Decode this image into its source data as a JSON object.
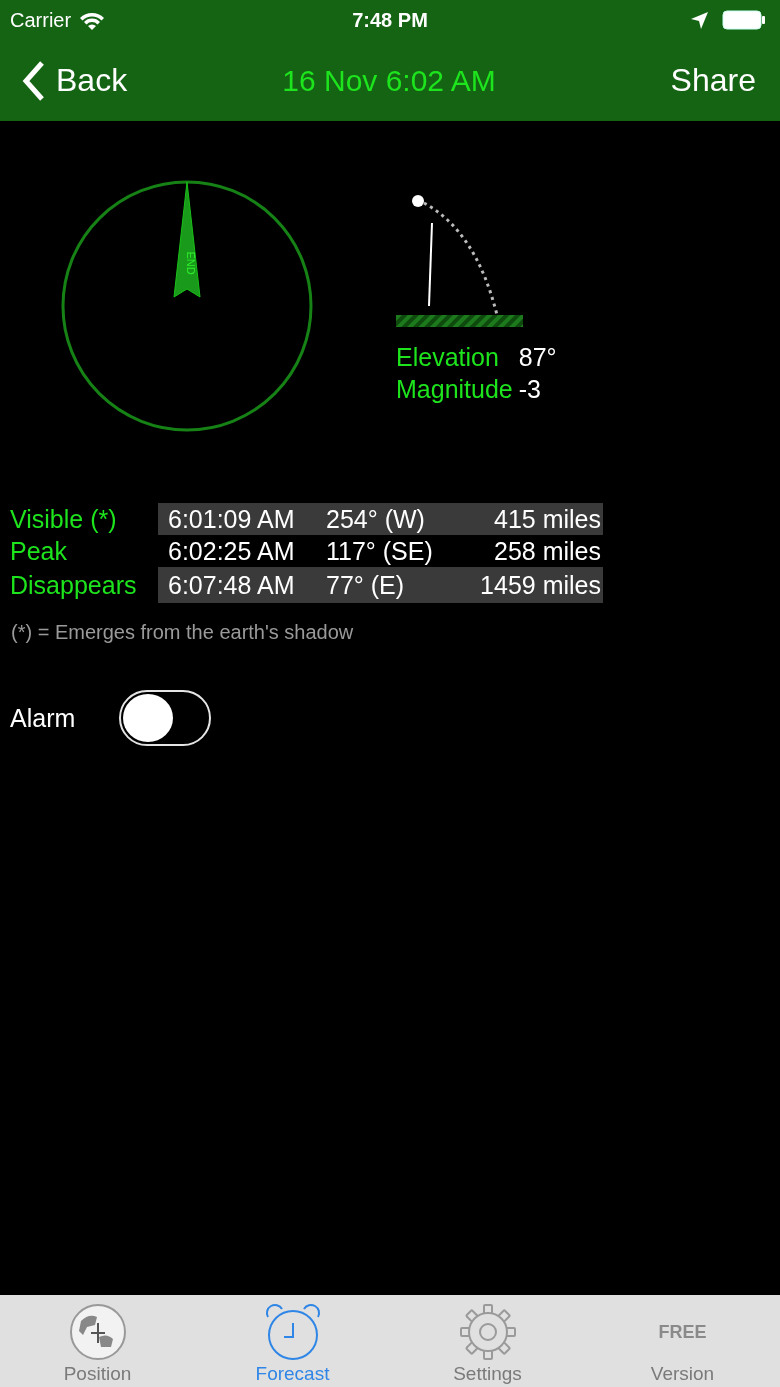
{
  "status_bar": {
    "carrier": "Carrier",
    "time": "7:48 PM"
  },
  "nav_bar": {
    "back": "Back",
    "title": "16 Nov 6:02 AM",
    "action": "Share"
  },
  "compass": {
    "pointer_label": "END"
  },
  "elevation": {
    "rows": [
      {
        "label": "Elevation",
        "value": "87°"
      },
      {
        "label": "Magnitude",
        "value": "-3"
      }
    ]
  },
  "pass_table": {
    "rows": [
      {
        "label": "Visible (*)",
        "time": "6:01:09 AM",
        "direction": "254° (W)",
        "distance": "415 miles"
      },
      {
        "label": "Peak",
        "time": "6:02:25 AM",
        "direction": "117° (SE)",
        "distance": "258 miles"
      },
      {
        "label": "Disappears",
        "time": "6:07:48 AM",
        "direction": "77° (E)",
        "distance": "1459 miles"
      }
    ]
  },
  "footnote": "(*) = Emerges from the earth's shadow",
  "alarm": {
    "label": "Alarm",
    "on": false
  },
  "tab_bar": [
    {
      "kind": "globe",
      "label": "Position",
      "selected": false
    },
    {
      "kind": "alarm",
      "label": "Forecast",
      "selected": true
    },
    {
      "kind": "gear",
      "label": "Settings",
      "selected": false
    },
    {
      "kind": "free",
      "label": "Version",
      "selected": false,
      "icon_text": "FREE"
    }
  ]
}
